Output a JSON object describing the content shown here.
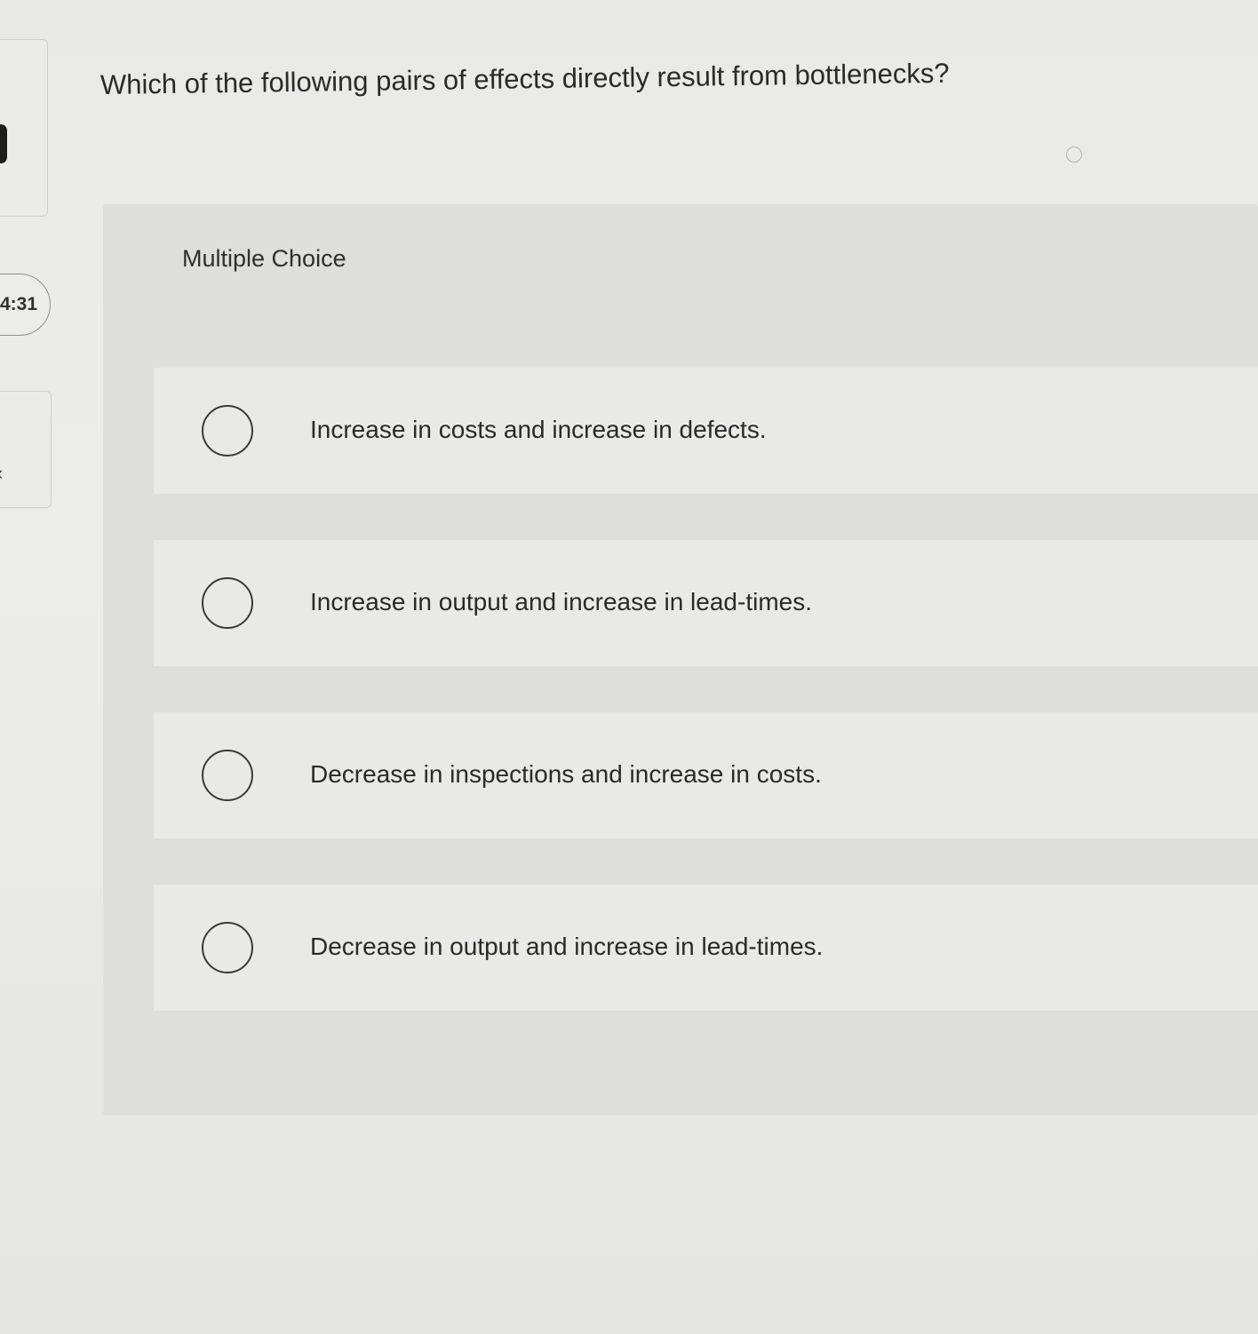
{
  "timer": {
    "text": "4:31"
  },
  "question": {
    "text": "Which of the following pairs of effects directly result from bottlenecks?",
    "type_label": "Multiple Choice"
  },
  "options": [
    {
      "label": "Increase in costs and increase in defects.",
      "selected": false
    },
    {
      "label": "Increase in output and increase in lead-times.",
      "selected": false
    },
    {
      "label": "Decrease in inspections and increase in costs.",
      "selected": false
    },
    {
      "label": "Decrease in output and increase in lead-times.",
      "selected": false
    }
  ],
  "icons": {
    "collapse": "chevron-left-icon",
    "radio": "radio-button-icon"
  }
}
